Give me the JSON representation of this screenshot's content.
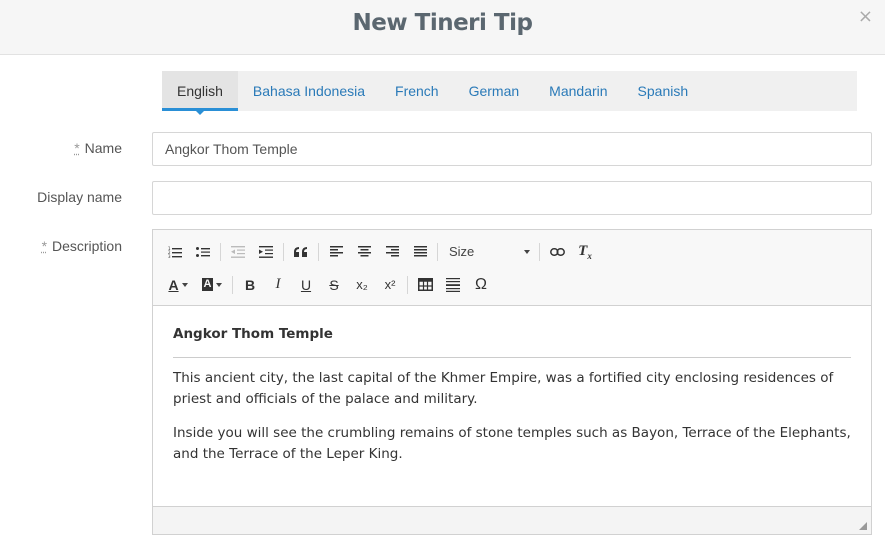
{
  "modal": {
    "title": "New Tineri Tip",
    "close_icon": "×"
  },
  "tabs": [
    {
      "label": "English",
      "active": true
    },
    {
      "label": "Bahasa Indonesia"
    },
    {
      "label": "French"
    },
    {
      "label": "German"
    },
    {
      "label": "Mandarin"
    },
    {
      "label": "Spanish"
    }
  ],
  "form": {
    "required_marker": "*",
    "name_label": "Name",
    "name_value": "Angkor Thom Temple",
    "display_name_label": "Display name",
    "display_name_value": "",
    "description_label": "Description"
  },
  "toolbar": {
    "size_label": "Size",
    "icons": [
      "numbered-list-icon",
      "bulleted-list-icon",
      "outdent-icon",
      "indent-icon",
      "blockquote-icon",
      "align-left-icon",
      "align-center-icon",
      "align-right-icon",
      "justify-icon",
      "link-icon",
      "clear-format-icon",
      "text-color-icon",
      "background-color-icon",
      "bold-icon",
      "italic-icon",
      "underline-icon",
      "strikethrough-icon",
      "subscript-icon",
      "superscript-icon",
      "table-icon",
      "horizontal-line-icon",
      "special-character-icon"
    ],
    "glyphs": {
      "bold": "B",
      "italic": "I",
      "underline": "U",
      "strike": "S",
      "sub": "x₂",
      "sup": "x²",
      "omega": "Ω",
      "text_color": "A",
      "clear_format": "Tx"
    }
  },
  "description": {
    "heading": "Angkor Thom Temple",
    "paragraphs": [
      "This ancient city, the last capital of the Khmer Empire, was a fortified city enclosing residences of priest and officials of the palace and military.",
      "Inside you will see the crumbling remains of stone temples such as Bayon, Terrace of the Elephants, and the Terrace of the Leper King."
    ]
  }
}
